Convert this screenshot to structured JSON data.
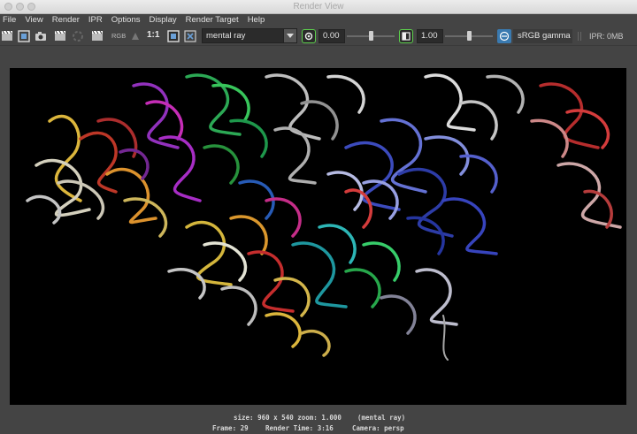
{
  "window": {
    "title": "Render View"
  },
  "menu": [
    "File",
    "View",
    "Render",
    "IPR",
    "Options",
    "Display",
    "Render Target",
    "Help"
  ],
  "toolbar": {
    "rgb_label": "RGB",
    "ratio_label": "1:1",
    "renderer": "mental ray",
    "exposure": "0.00",
    "gamma": "1.00",
    "color_space": "sRGB gamma",
    "ipr_memory": "IPR: 0MB"
  },
  "colors": {
    "toolbar_bg": "#444444",
    "render_bg": "#000000",
    "accent_green": "#5ccf4c",
    "accent_blue": "#3a7ab0"
  },
  "status": {
    "line1": "size: 960 x 540 zoom: 1.000",
    "renderer": "(mental ray)",
    "frame": "Frame: 29",
    "render_time": "Render Time: 3:16",
    "camera": "Camera: persp"
  }
}
